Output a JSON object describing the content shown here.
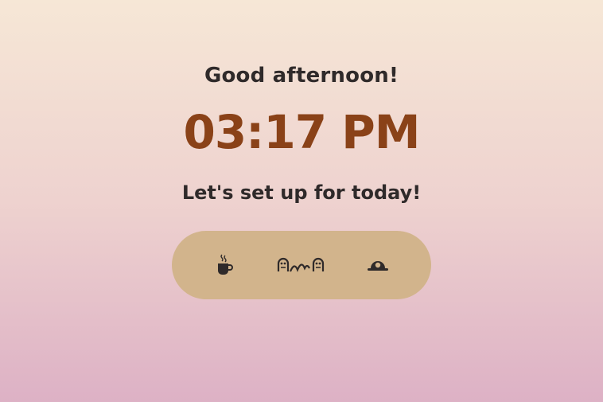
{
  "greeting": "Good afternoon!",
  "time": "03:17 PM",
  "prompt": "Let's set up for today!",
  "options": [
    {
      "icon": "coffee-cup-icon"
    },
    {
      "icon": "family-icon"
    },
    {
      "icon": "sunset-icon"
    }
  ],
  "colors": {
    "time": "#8a4218",
    "pill": "#d2b48c",
    "text": "#2f2a2a",
    "bg_top": "#f6e7d6",
    "bg_bottom": "#ddb1c5"
  }
}
